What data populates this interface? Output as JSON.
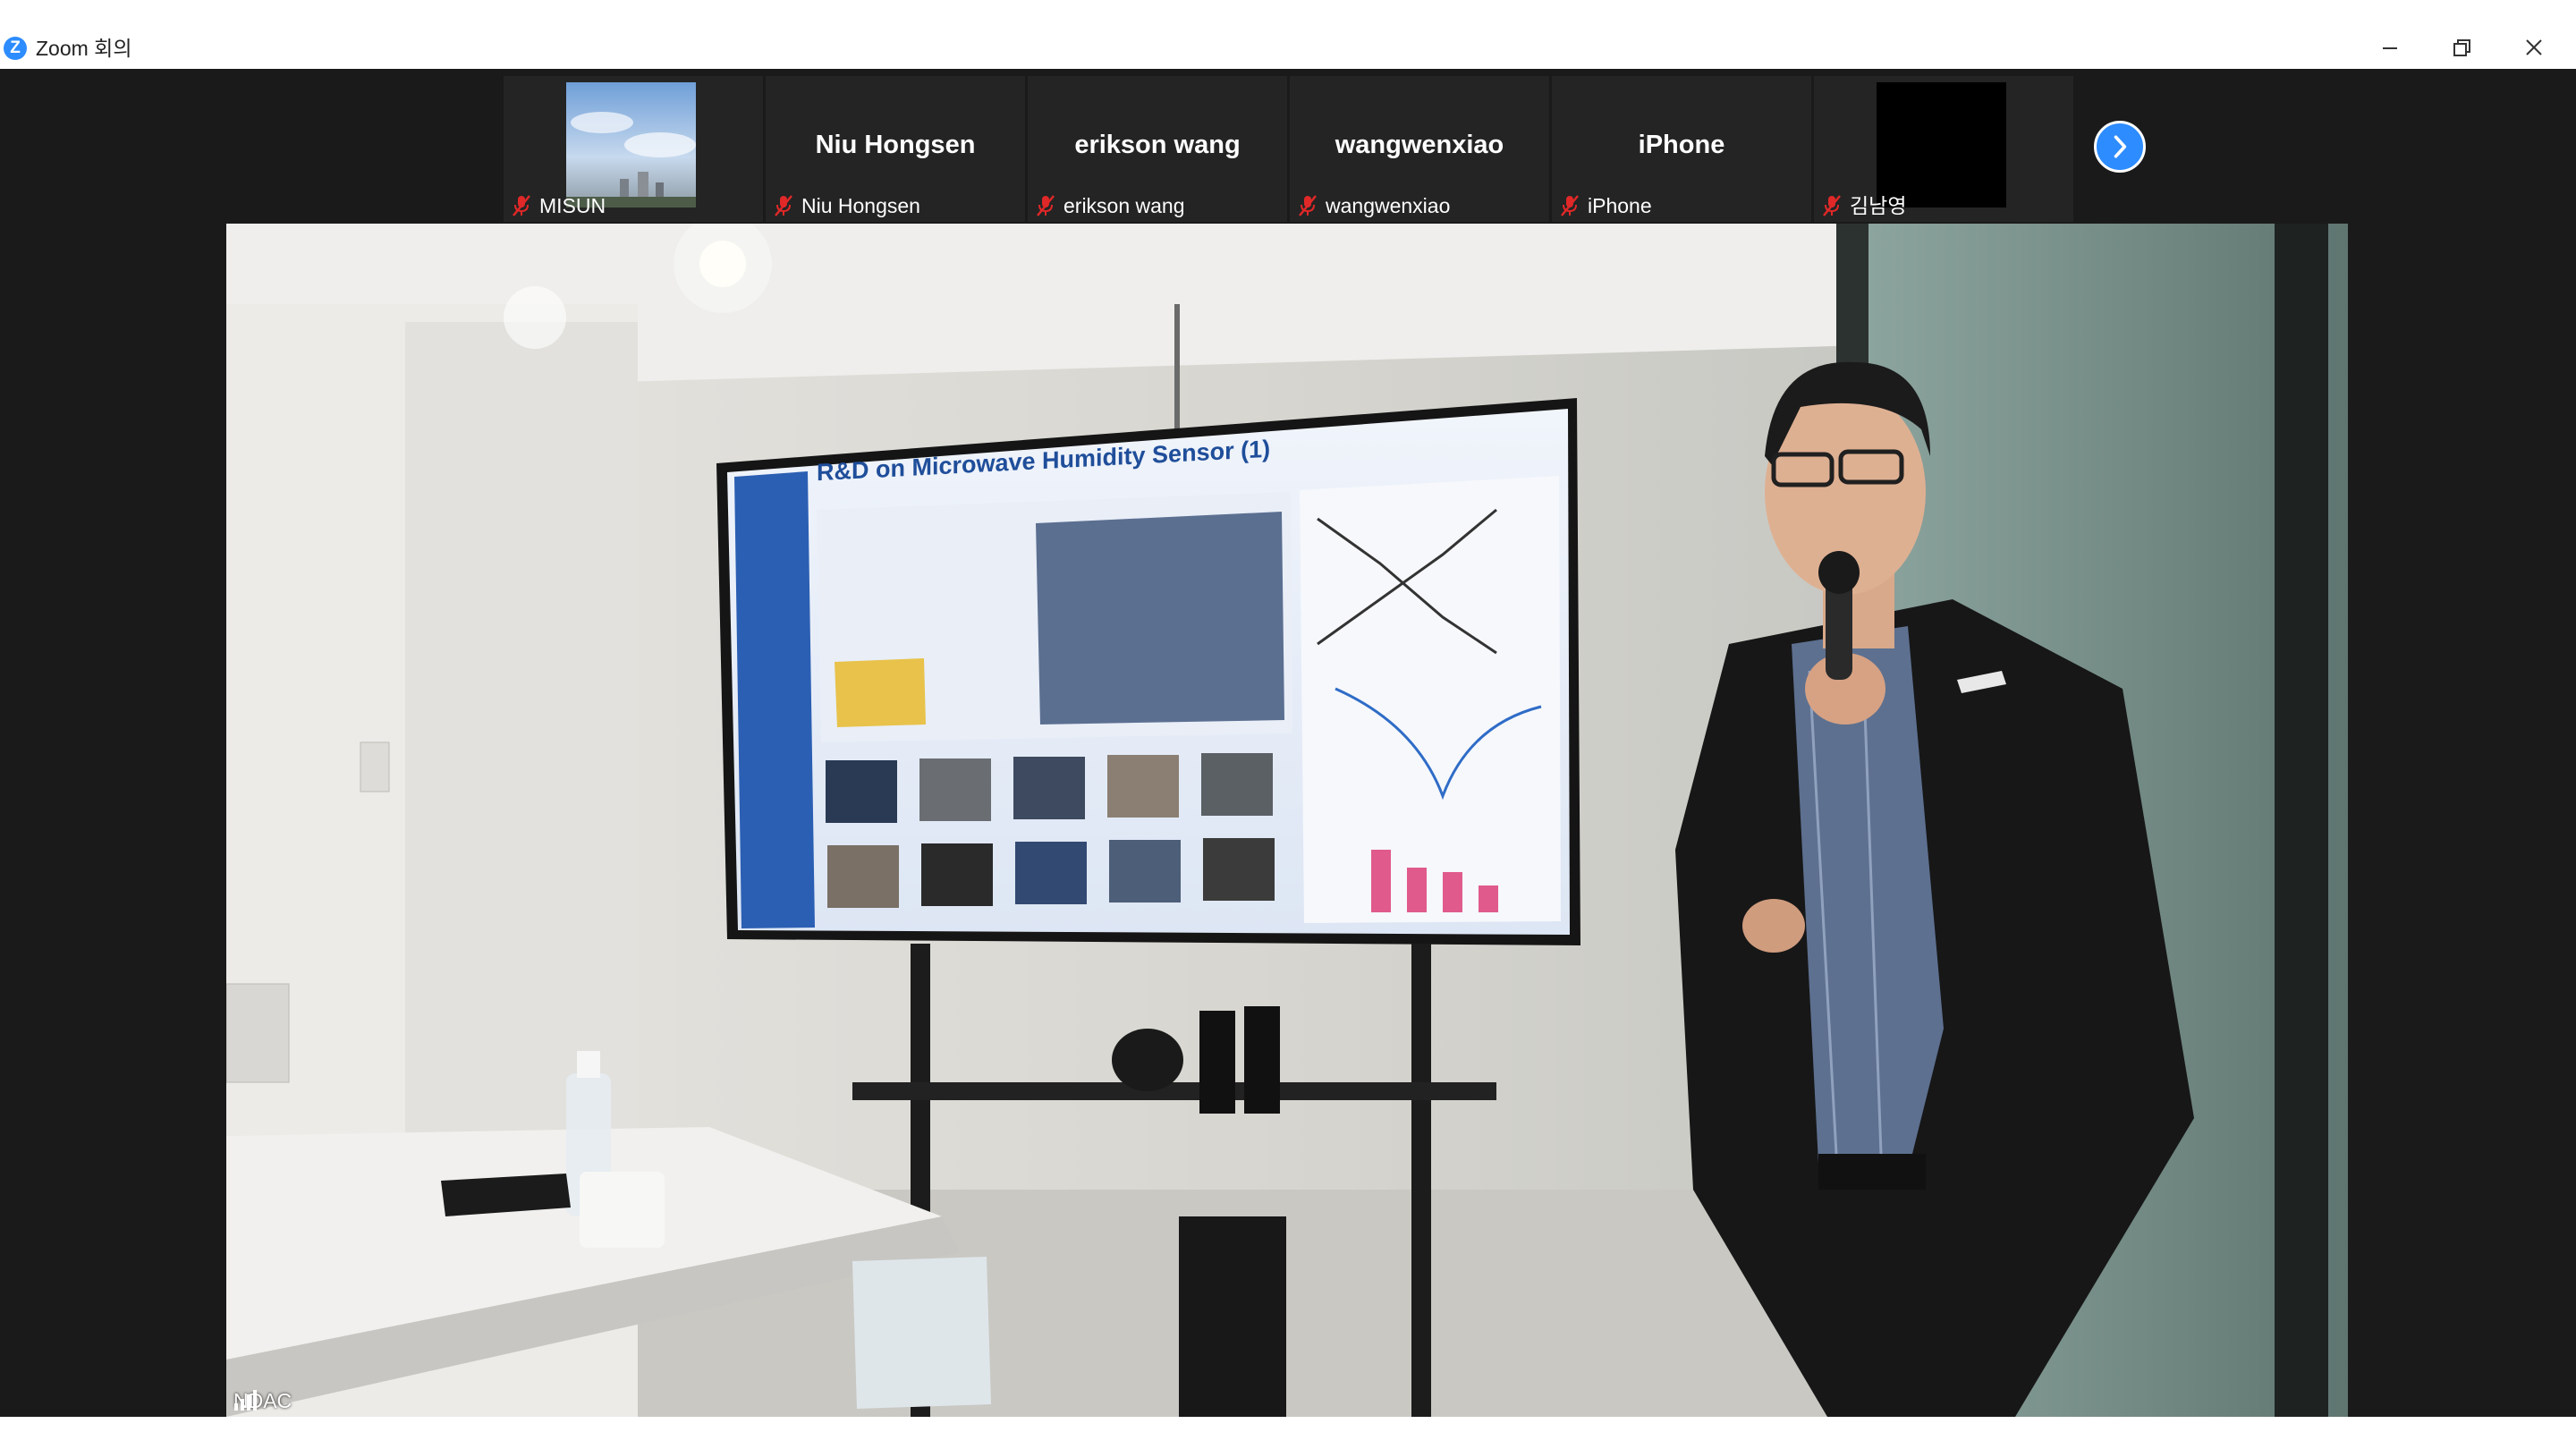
{
  "window": {
    "title": "Zoom 회의",
    "app_icon_letter": "Z",
    "controls": [
      "minimize-icon",
      "restore-icon",
      "close-icon"
    ]
  },
  "participants": [
    {
      "id": "misun",
      "label": "MISUN",
      "has_video": true,
      "video_type": "sky-photo",
      "muted": true
    },
    {
      "id": "niu",
      "label": "Niu Hongsen",
      "center_name": "Niu Hongsen",
      "has_video": false,
      "muted": true
    },
    {
      "id": "erikson",
      "label": "erikson wang",
      "center_name": "erikson wang",
      "has_video": false,
      "muted": true
    },
    {
      "id": "wangwen",
      "label": "wangwenxiao",
      "center_name": "wangwenxiao",
      "has_video": false,
      "muted": true
    },
    {
      "id": "iphone",
      "label": "iPhone",
      "center_name": "iPhone",
      "has_video": false,
      "muted": true
    },
    {
      "id": "kim",
      "label": "김남영",
      "has_video": true,
      "video_type": "black",
      "muted": true
    }
  ],
  "strip_nav": {
    "icon": "chevron-right-icon"
  },
  "active_speaker": {
    "label": "NDAC",
    "signal_icon": "signal-bars-icon"
  },
  "slide": {
    "title": "R&D on Microwave Humidity Sensor (1)"
  },
  "colors": {
    "accent": "#2d8cff",
    "muted_red": "#e02828",
    "background": "#1a1a1a",
    "tile": "#242424"
  }
}
